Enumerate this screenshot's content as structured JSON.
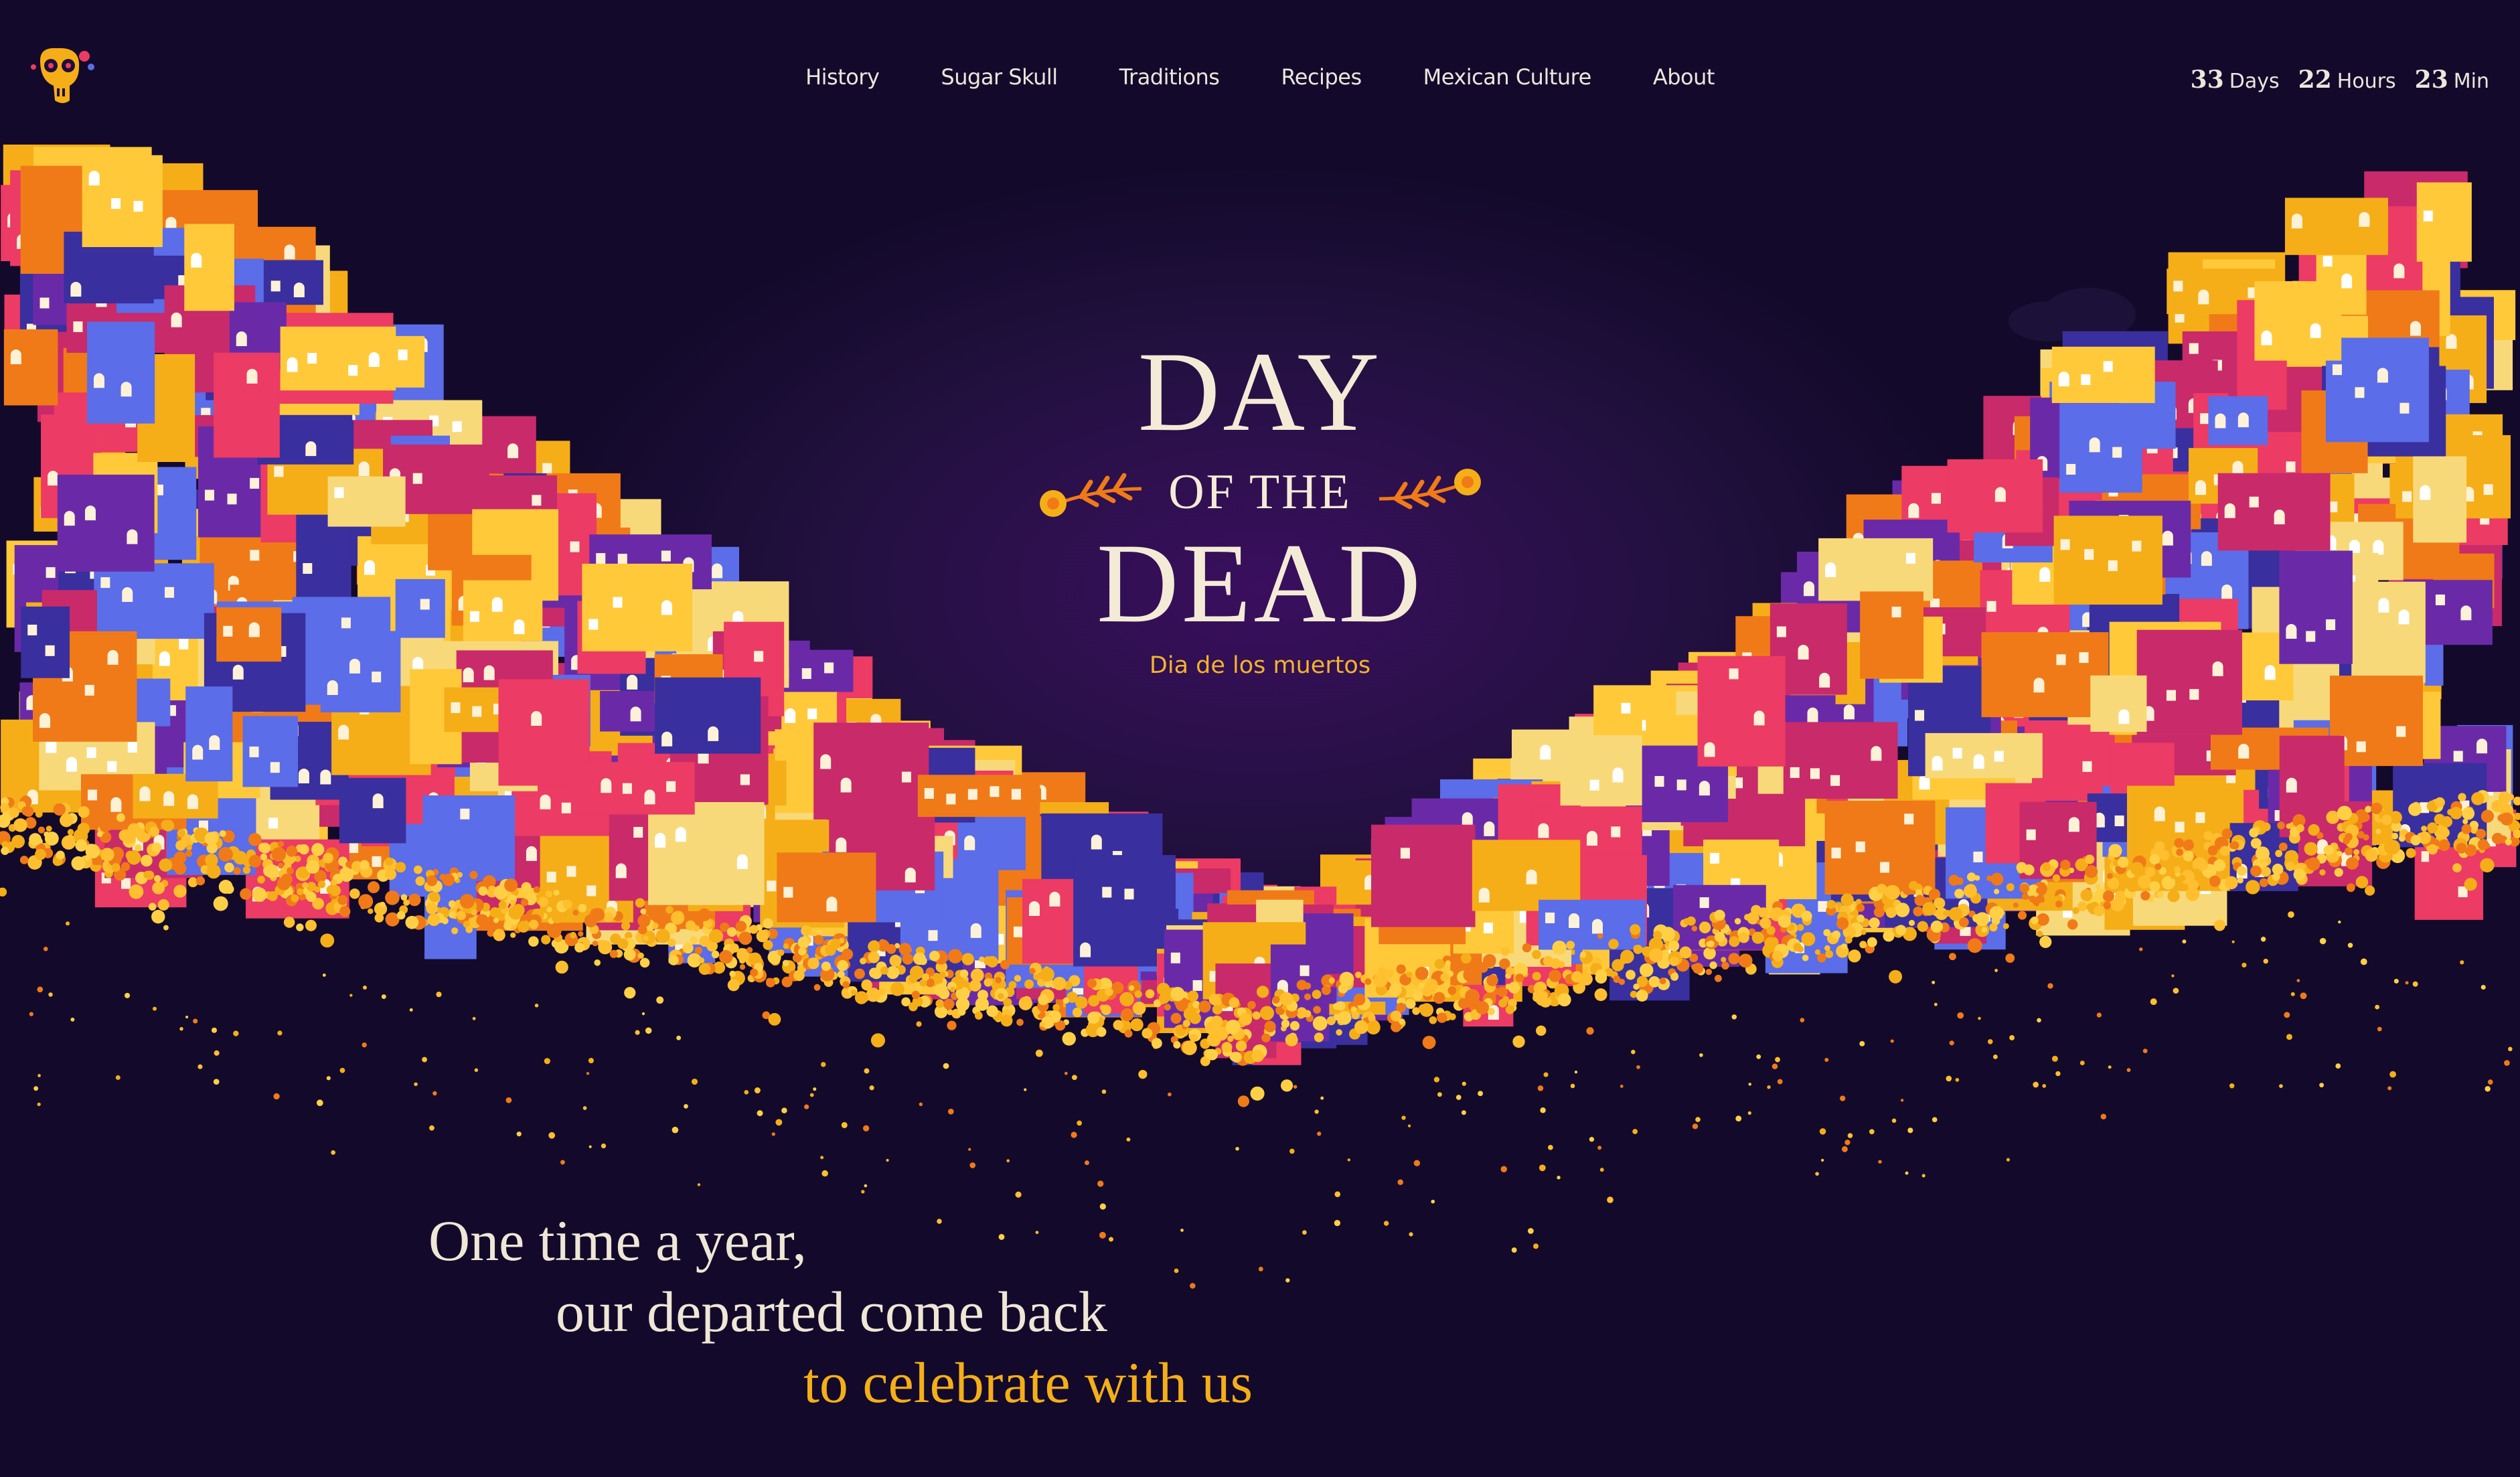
{
  "logo": {
    "name": "sugar-skull-logo"
  },
  "nav": {
    "items": [
      {
        "label": "History"
      },
      {
        "label": "Sugar Skull"
      },
      {
        "label": "Traditions"
      },
      {
        "label": "Recipes"
      },
      {
        "label": "Mexican Culture"
      },
      {
        "label": "About"
      }
    ]
  },
  "countdown": {
    "days": {
      "value": "33",
      "unit": "Days"
    },
    "hours": {
      "value": "22",
      "unit": "Hours"
    },
    "minutes": {
      "value": "23",
      "unit": "Min"
    }
  },
  "hero": {
    "title_line1": "DAY",
    "title_line2": "OF THE",
    "title_line3": "DEAD",
    "subtitle": "Dia de los muertos"
  },
  "tagline": {
    "line1": "One time a year,",
    "line2": "our departed come back",
    "line3": "to celebrate with us"
  },
  "colors": {
    "background": "#130a2b",
    "accent": "#f5ae18",
    "text": "#ece6dc",
    "building_palette": [
      "#f5ae18",
      "#ffc93a",
      "#f8d97a",
      "#ec3b64",
      "#f07a18",
      "#5b6de8",
      "#3a2f9e",
      "#6a2aa8",
      "#c92a6a"
    ]
  }
}
